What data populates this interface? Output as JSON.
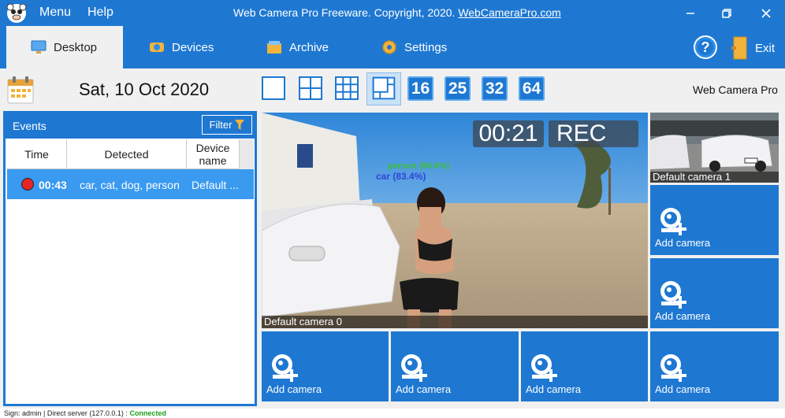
{
  "titlebar": {
    "menu_label": "Menu",
    "help_label": "Help",
    "title_text": "Web Camera Pro  Freeware. Copyright, 2020. ",
    "title_link": "WebCameraPro.com"
  },
  "tabs": [
    {
      "label": "Desktop",
      "icon": "monitor-icon",
      "active": true
    },
    {
      "label": "Devices",
      "icon": "webcam-icon",
      "active": false
    },
    {
      "label": "Archive",
      "icon": "archive-icon",
      "active": false
    },
    {
      "label": "Settings",
      "icon": "gear-icon",
      "active": false
    }
  ],
  "help": {
    "glyph": "?"
  },
  "exit": {
    "label": "Exit"
  },
  "toolbar": {
    "date": "Sat, 10 Oct 2020",
    "app_name": "Web Camera Pro",
    "grid_buttons": [
      "16",
      "25",
      "32",
      "64"
    ]
  },
  "events": {
    "title": "Events",
    "filter_label": "Filter",
    "columns": [
      "Time",
      "Detected",
      "Device name"
    ],
    "rows": [
      {
        "time": "00:43",
        "detected": "car, cat, dog, person",
        "device": "Default ..."
      }
    ]
  },
  "main_camera": {
    "timer": "00:21",
    "rec": "REC",
    "label": "Default camera 0",
    "detection_label": "car (83.4%)",
    "detection_label_2": "person (86.8%)"
  },
  "camera_1": {
    "label": "Default camera 1"
  },
  "add_camera_label": "Add camera",
  "status": {
    "sign": "Sign: admin",
    "server": "Direct server (127.0.0.1) :",
    "state": "Connected"
  },
  "colors": {
    "accent": "#1e78d2",
    "selected_row": "#3a9af0",
    "record_dot": "#e32626",
    "connected": "#1a9d1a"
  }
}
